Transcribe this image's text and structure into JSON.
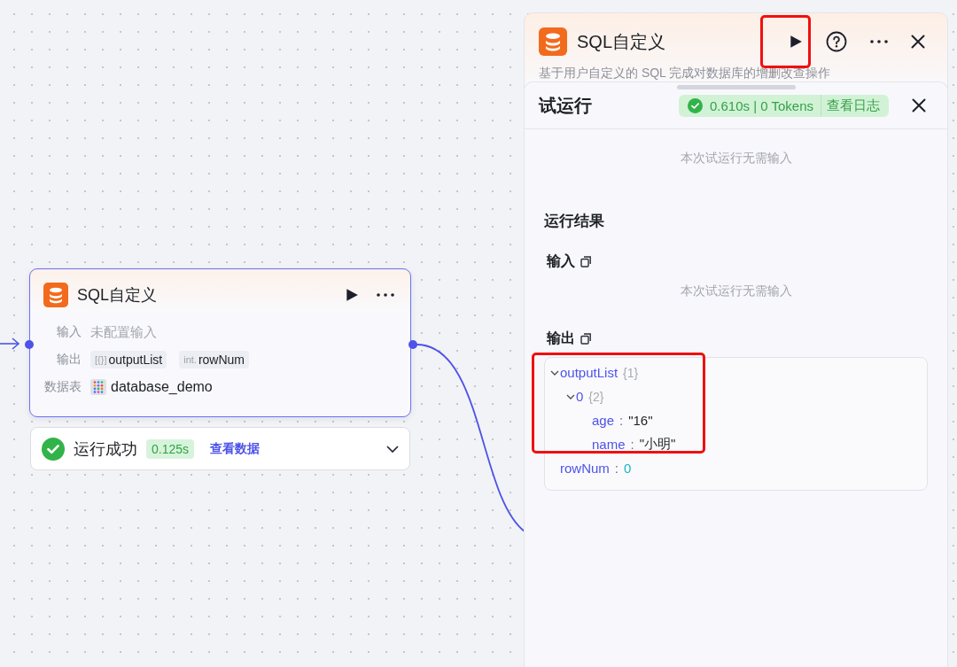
{
  "node": {
    "title": "SQL自定义",
    "rows": [
      {
        "kind": "text",
        "label": "输入",
        "value": "未配置输入"
      },
      {
        "kind": "tags",
        "label": "输出",
        "tags": [
          {
            "type": "[{}]",
            "name": "outputList"
          },
          {
            "type": "int.",
            "name": "rowNum"
          }
        ]
      },
      {
        "kind": "database",
        "label": "数据表",
        "value": "database_demo"
      }
    ]
  },
  "run_status": {
    "label": "运行成功",
    "time": "0.125s",
    "link": "查看数据",
    "expanded": false
  },
  "side_panel": {
    "title": "SQL自定义",
    "description": "基于用户自定义的 SQL 完成对数据库的增删改查操作"
  },
  "test_run": {
    "title": "试运行",
    "duration": "0.610s",
    "metrics_separator": "|",
    "tokens": "0 Tokens",
    "log_link": "查看日志",
    "note": "本次试运行无需输入",
    "result_heading": "运行结果",
    "input": {
      "label": "输入",
      "note": "本次试运行无需输入"
    },
    "output": {
      "label": "输出",
      "tree": [
        {
          "key": "outputList",
          "count": "{1}",
          "expanded": true,
          "children": [
            {
              "key": "0",
              "count": "{2}",
              "expanded": true,
              "children": [
                {
                  "key": "age",
                  "separator": ":",
                  "value": "\"16\"",
                  "kind": "string"
                },
                {
                  "key": "name",
                  "separator": ":",
                  "value": "\"小明\"",
                  "kind": "string"
                }
              ]
            }
          ]
        },
        {
          "key": "rowNum",
          "separator": ":",
          "value": "0",
          "kind": "number"
        }
      ]
    }
  }
}
